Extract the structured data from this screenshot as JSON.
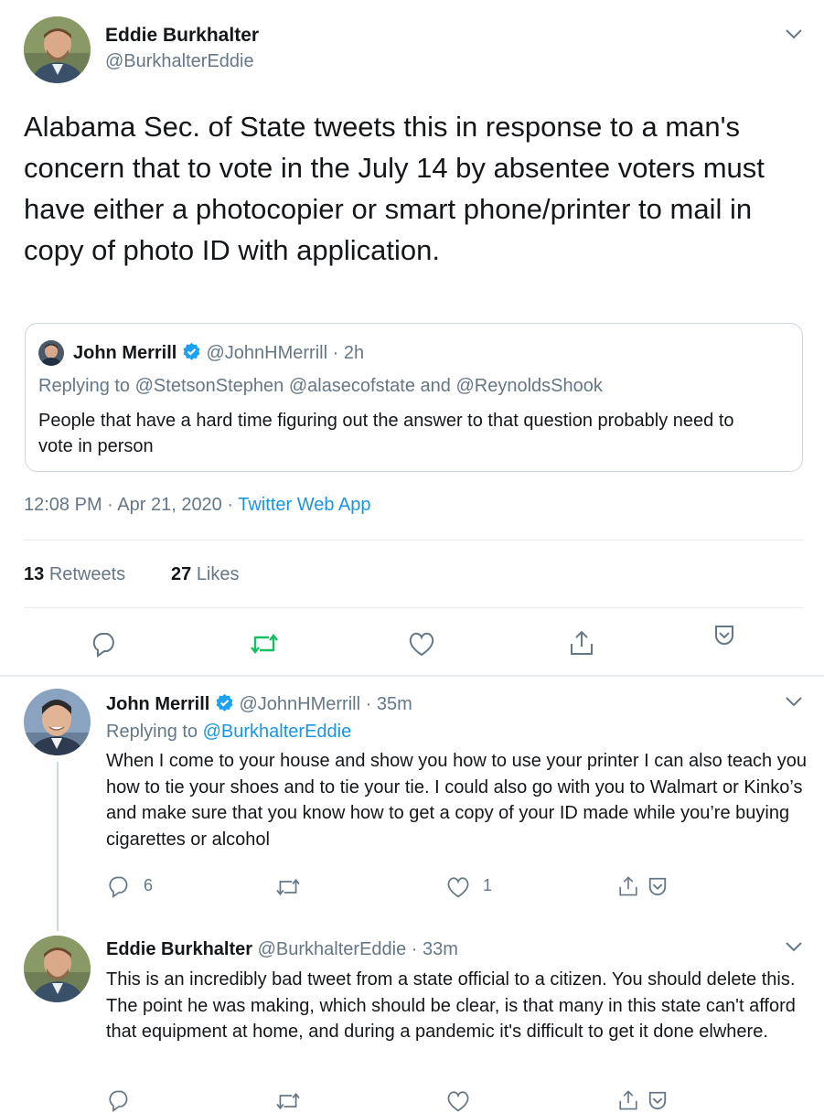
{
  "main_tweet": {
    "author_name": "Eddie Burkhalter",
    "author_handle": "@BurkhalterEddie",
    "text": "Alabama Sec. of State tweets this in response to a man's concern that to vote in the July 14 by absentee voters must have either a photocopier or smart phone/printer to mail in copy of photo ID with application.",
    "quoted": {
      "author_name": "John Merrill",
      "author_handle": "@JohnHMerrill",
      "time": "· 2h",
      "replying_to_label": "Replying to",
      "replying_to": "@StetsonStephen @alasecofstate and @ReynoldsShook",
      "text": "People that have a hard time figuring out the answer to that question probably need to vote in person"
    },
    "timestamp": "12:08 PM · Apr 21, 2020 ·",
    "source": "Twitter Web App",
    "retweets_count": "13",
    "retweets_label": "Retweets",
    "likes_count": "27",
    "likes_label": "Likes"
  },
  "reply_1": {
    "author_name": "John Merrill",
    "author_handle": "@JohnHMerrill",
    "time": "· 35m",
    "replying_to_label": "Replying to",
    "replying_to": "@BurkhalterEddie",
    "text": "When I come to your house and show you how to use your printer I can also teach you how to tie your shoes and to tie your tie. I could also go with you to Walmart or Kinko’s and make sure that you know how to get a copy of your ID made while you’re buying cigarettes or alcohol",
    "reply_count": "6",
    "like_count": "1"
  },
  "reply_2": {
    "author_name": "Eddie Burkhalter",
    "author_handle": "@BurkhalterEddie",
    "time": "· 33m",
    "text": "This is an incredibly bad tweet from a state official to a citizen. You should delete this. The point he was making, which should be clear, is that many in this state can't afford that equipment at home, and during a pandemic it's difficult to get it done elwhere."
  },
  "colors": {
    "accent": "#1b95e0",
    "retweet_green": "#17bf63",
    "muted": "#657786",
    "border": "#e1e8ed"
  }
}
